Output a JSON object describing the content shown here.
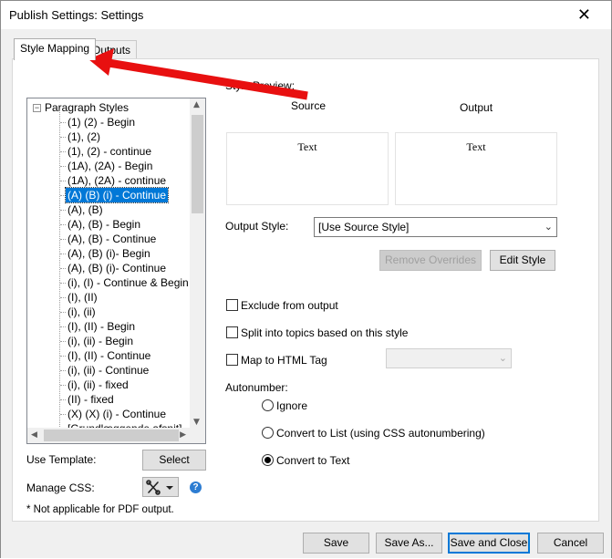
{
  "window": {
    "title": "Publish Settings: Settings",
    "close_glyph": "✕"
  },
  "tabs": [
    {
      "label": "Style Mapping",
      "active": true
    },
    {
      "label": "Outputs",
      "active": false
    }
  ],
  "tree": {
    "root_label": "Paragraph Styles",
    "root_expander": "−",
    "items": [
      "(1) (2) - Begin",
      "(1), (2)",
      "(1), (2) - continue",
      "(1A), (2A) - Begin",
      "(1A), (2A) - continue",
      "(A) (B) (i) - Continue",
      "(A), (B)",
      "(A), (B) - Begin",
      "(A), (B) - Continue",
      "(A), (B) (i)- Begin",
      "(A), (B) (i)- Continue",
      "(i), (I) - Continue & Begin",
      "(I), (II)",
      "(i), (ii)",
      "(I), (II) - Begin",
      "(i), (ii) - Begin",
      "(I), (II) - Continue",
      "(i), (ii) - Continue",
      "(i), (ii) - fixed",
      "(II) - fixed",
      "(X) (X) (i) - Continue",
      "[Grundlæggende afsnit]"
    ],
    "selected_index": 5
  },
  "preview": {
    "header": "Style Preview:",
    "source_label": "Source",
    "output_label": "Output",
    "source_text": "Text",
    "output_text": "Text"
  },
  "output_style": {
    "label": "Output Style:",
    "value": "[Use Source Style]"
  },
  "buttons": {
    "remove_overrides": "Remove Overrides",
    "edit_style": "Edit Style",
    "select": "Select",
    "save": "Save",
    "save_as": "Save As...",
    "save_and_close": "Save and Close",
    "cancel": "Cancel"
  },
  "options": {
    "exclude": "Exclude from output",
    "split": "Split into topics based on this style",
    "map_html": "Map to HTML Tag",
    "map_html_value": ""
  },
  "autonumber": {
    "label": "Autonumber:",
    "choices": [
      "Ignore",
      "Convert to List (using CSS autonumbering)",
      "Convert to Text"
    ],
    "selected_index": 2
  },
  "left_bottom": {
    "use_template": "Use Template:",
    "manage_css": "Manage CSS:",
    "footnote": "* Not applicable for PDF output.",
    "help_glyph": "?"
  },
  "annotation": {
    "arrow_color": "#e81010"
  },
  "colors": {
    "selection": "#0078d7",
    "accent_border": "#0078d7"
  }
}
